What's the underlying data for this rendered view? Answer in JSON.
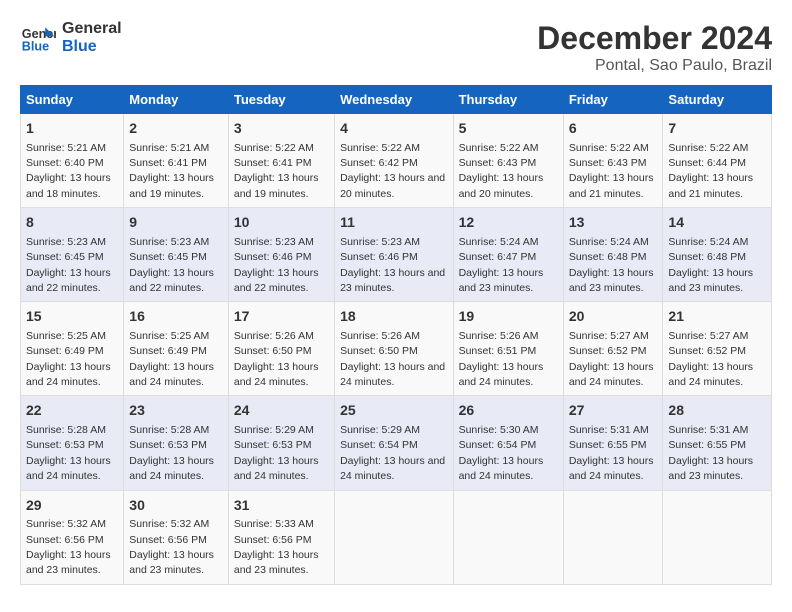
{
  "logo": {
    "line1": "General",
    "line2": "Blue"
  },
  "title": "December 2024",
  "subtitle": "Pontal, Sao Paulo, Brazil",
  "days_header": [
    "Sunday",
    "Monday",
    "Tuesday",
    "Wednesday",
    "Thursday",
    "Friday",
    "Saturday"
  ],
  "weeks": [
    [
      {
        "day": "1",
        "sunrise": "5:21 AM",
        "sunset": "6:40 PM",
        "daylight": "13 hours and 18 minutes."
      },
      {
        "day": "2",
        "sunrise": "5:21 AM",
        "sunset": "6:41 PM",
        "daylight": "13 hours and 19 minutes."
      },
      {
        "day": "3",
        "sunrise": "5:22 AM",
        "sunset": "6:41 PM",
        "daylight": "13 hours and 19 minutes."
      },
      {
        "day": "4",
        "sunrise": "5:22 AM",
        "sunset": "6:42 PM",
        "daylight": "13 hours and 20 minutes."
      },
      {
        "day": "5",
        "sunrise": "5:22 AM",
        "sunset": "6:43 PM",
        "daylight": "13 hours and 20 minutes."
      },
      {
        "day": "6",
        "sunrise": "5:22 AM",
        "sunset": "6:43 PM",
        "daylight": "13 hours and 21 minutes."
      },
      {
        "day": "7",
        "sunrise": "5:22 AM",
        "sunset": "6:44 PM",
        "daylight": "13 hours and 21 minutes."
      }
    ],
    [
      {
        "day": "8",
        "sunrise": "5:23 AM",
        "sunset": "6:45 PM",
        "daylight": "13 hours and 22 minutes."
      },
      {
        "day": "9",
        "sunrise": "5:23 AM",
        "sunset": "6:45 PM",
        "daylight": "13 hours and 22 minutes."
      },
      {
        "day": "10",
        "sunrise": "5:23 AM",
        "sunset": "6:46 PM",
        "daylight": "13 hours and 22 minutes."
      },
      {
        "day": "11",
        "sunrise": "5:23 AM",
        "sunset": "6:46 PM",
        "daylight": "13 hours and 23 minutes."
      },
      {
        "day": "12",
        "sunrise": "5:24 AM",
        "sunset": "6:47 PM",
        "daylight": "13 hours and 23 minutes."
      },
      {
        "day": "13",
        "sunrise": "5:24 AM",
        "sunset": "6:48 PM",
        "daylight": "13 hours and 23 minutes."
      },
      {
        "day": "14",
        "sunrise": "5:24 AM",
        "sunset": "6:48 PM",
        "daylight": "13 hours and 23 minutes."
      }
    ],
    [
      {
        "day": "15",
        "sunrise": "5:25 AM",
        "sunset": "6:49 PM",
        "daylight": "13 hours and 24 minutes."
      },
      {
        "day": "16",
        "sunrise": "5:25 AM",
        "sunset": "6:49 PM",
        "daylight": "13 hours and 24 minutes."
      },
      {
        "day": "17",
        "sunrise": "5:26 AM",
        "sunset": "6:50 PM",
        "daylight": "13 hours and 24 minutes."
      },
      {
        "day": "18",
        "sunrise": "5:26 AM",
        "sunset": "6:50 PM",
        "daylight": "13 hours and 24 minutes."
      },
      {
        "day": "19",
        "sunrise": "5:26 AM",
        "sunset": "6:51 PM",
        "daylight": "13 hours and 24 minutes."
      },
      {
        "day": "20",
        "sunrise": "5:27 AM",
        "sunset": "6:52 PM",
        "daylight": "13 hours and 24 minutes."
      },
      {
        "day": "21",
        "sunrise": "5:27 AM",
        "sunset": "6:52 PM",
        "daylight": "13 hours and 24 minutes."
      }
    ],
    [
      {
        "day": "22",
        "sunrise": "5:28 AM",
        "sunset": "6:53 PM",
        "daylight": "13 hours and 24 minutes."
      },
      {
        "day": "23",
        "sunrise": "5:28 AM",
        "sunset": "6:53 PM",
        "daylight": "13 hours and 24 minutes."
      },
      {
        "day": "24",
        "sunrise": "5:29 AM",
        "sunset": "6:53 PM",
        "daylight": "13 hours and 24 minutes."
      },
      {
        "day": "25",
        "sunrise": "5:29 AM",
        "sunset": "6:54 PM",
        "daylight": "13 hours and 24 minutes."
      },
      {
        "day": "26",
        "sunrise": "5:30 AM",
        "sunset": "6:54 PM",
        "daylight": "13 hours and 24 minutes."
      },
      {
        "day": "27",
        "sunrise": "5:31 AM",
        "sunset": "6:55 PM",
        "daylight": "13 hours and 24 minutes."
      },
      {
        "day": "28",
        "sunrise": "5:31 AM",
        "sunset": "6:55 PM",
        "daylight": "13 hours and 23 minutes."
      }
    ],
    [
      {
        "day": "29",
        "sunrise": "5:32 AM",
        "sunset": "6:56 PM",
        "daylight": "13 hours and 23 minutes."
      },
      {
        "day": "30",
        "sunrise": "5:32 AM",
        "sunset": "6:56 PM",
        "daylight": "13 hours and 23 minutes."
      },
      {
        "day": "31",
        "sunrise": "5:33 AM",
        "sunset": "6:56 PM",
        "daylight": "13 hours and 23 minutes."
      },
      null,
      null,
      null,
      null
    ]
  ]
}
